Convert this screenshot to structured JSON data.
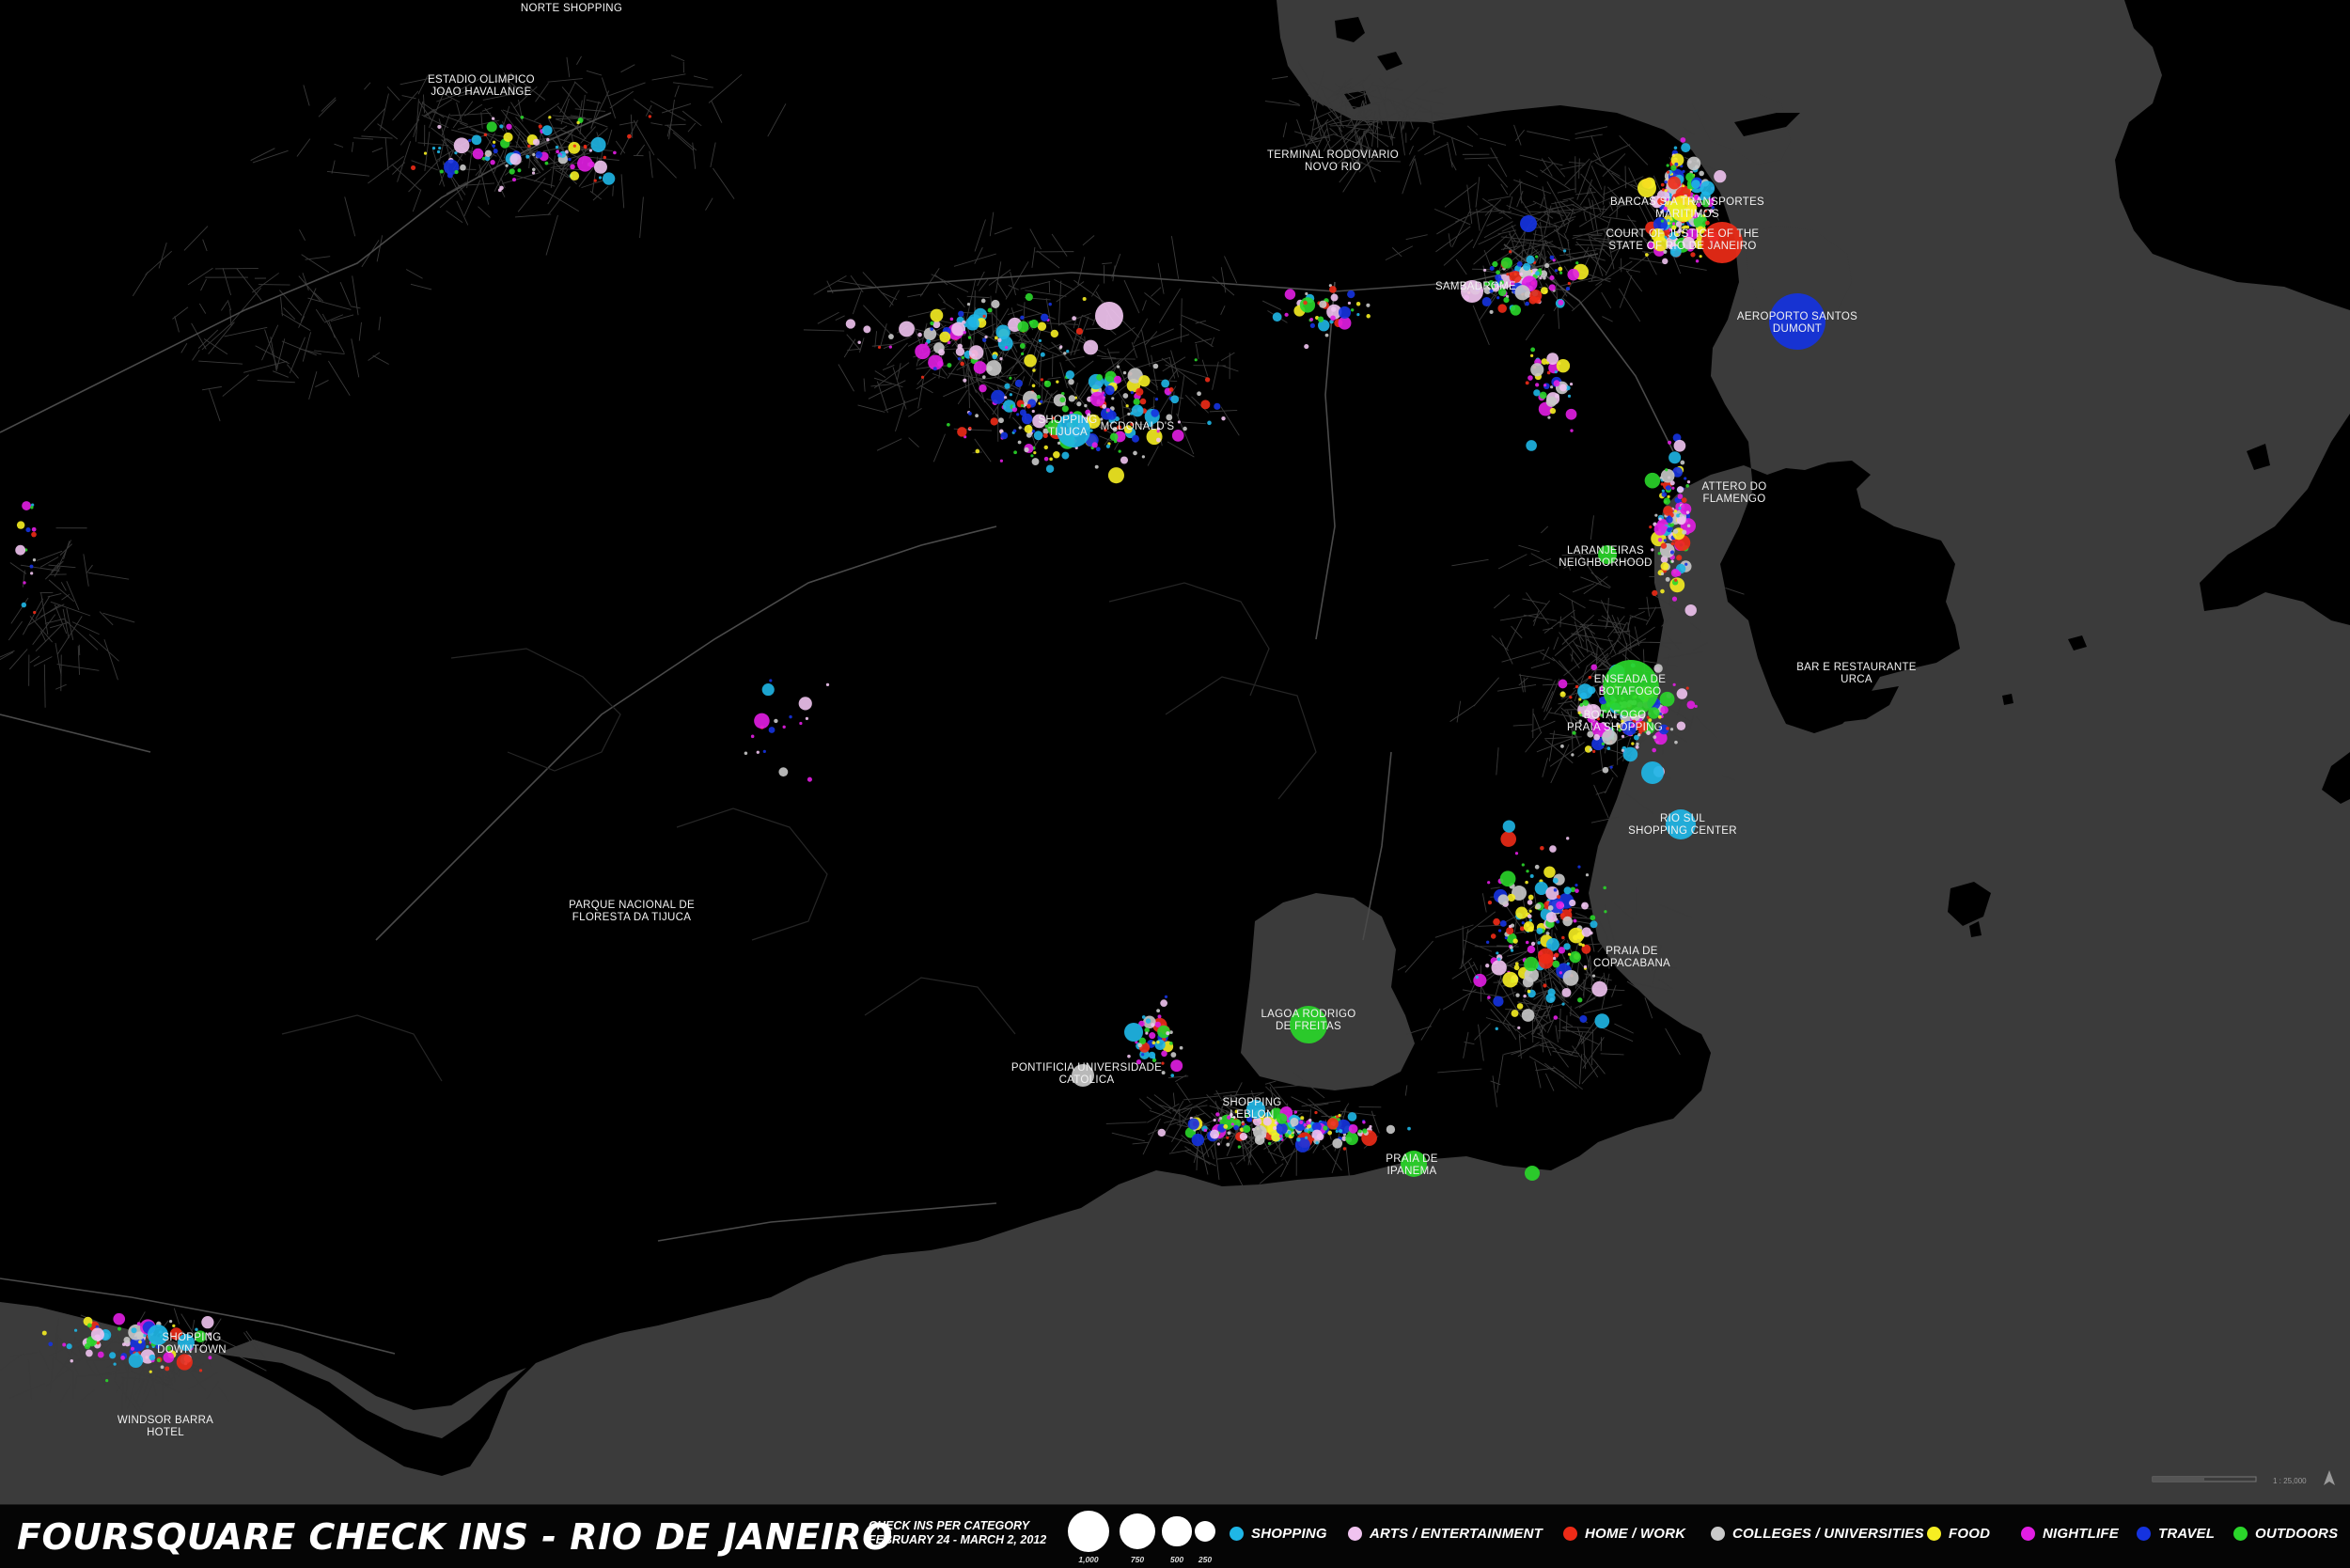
{
  "title": "FOURSQUARE CHECK INS - RIO DE JANEIRO",
  "subtitle": {
    "line1": "CHECK INS PER CATEGORY",
    "line2": "FEBRUARY 24 - MARCH 2, 2012"
  },
  "size_legend": [
    {
      "label": "1,000",
      "value": 1000
    },
    {
      "label": "750",
      "value": 750
    },
    {
      "label": "500",
      "value": 500
    },
    {
      "label": "250",
      "value": 250
    }
  ],
  "categories": [
    {
      "label": "SHOPPING",
      "color": "#1fb6e6"
    },
    {
      "label": "ARTS / ENTERTAINMENT",
      "color": "#f0c3ef"
    },
    {
      "label": "HOME / WORK",
      "color": "#ee2b17"
    },
    {
      "label": "COLLEGES / UNIVERSITIES",
      "color": "#c9c9c9"
    },
    {
      "label": "FOOD",
      "color": "#f6ee22"
    },
    {
      "label": "NIGHTLIFE",
      "color": "#e21ee3"
    },
    {
      "label": "TRAVEL",
      "color": "#1533e0"
    },
    {
      "label": "OUTDOORS",
      "color": "#2ad62a"
    }
  ],
  "map": {
    "water_color": "#3b3b3b",
    "land_color": "#000000",
    "scale_text": "1 : 25,000",
    "north_arrow_icon": "north-arrow-icon",
    "labels": [
      {
        "id": "norte-shopping",
        "lines": [
          "NORTE SHOPPING"
        ]
      },
      {
        "id": "estadio-olimpico",
        "lines": [
          "ESTADIO OLIMPICO",
          "JOAO HAVALANGE"
        ]
      },
      {
        "id": "terminal-rodoviario",
        "lines": [
          "TERMINAL RODOVIARIO",
          "NOVO RIO"
        ]
      },
      {
        "id": "barcas",
        "lines": [
          "BARCAS S/A TRANSPORTES",
          "MARITIMOS"
        ]
      },
      {
        "id": "court-of-justice",
        "lines": [
          "COURT OF JUSTICE OF THE",
          "STATE OF RIO DE JANEIRO"
        ]
      },
      {
        "id": "sambadrome",
        "lines": [
          "SAMBADROME"
        ]
      },
      {
        "id": "aeroporto-santos-dumont",
        "lines": [
          "AEROPORTO SANTOS",
          "DUMONT"
        ]
      },
      {
        "id": "shopping-tijuca",
        "lines": [
          "SHOPPING",
          "TIJUCA"
        ]
      },
      {
        "id": "mcdonalds",
        "lines": [
          "MCDONALD'S"
        ]
      },
      {
        "id": "attero-do-flamengo",
        "lines": [
          "ATTERO DO",
          "FLAMENGO"
        ]
      },
      {
        "id": "laranjeiras",
        "lines": [
          "LARANJEIRAS",
          "NEIGHBORHOOD"
        ]
      },
      {
        "id": "enseada-de-botafogo",
        "lines": [
          "ENSEADA DE",
          "BOTAFOGO"
        ]
      },
      {
        "id": "botafogo-praia-shopping",
        "lines": [
          "BOTAFOGO",
          "PRAIA SHOPPING"
        ]
      },
      {
        "id": "bar-e-restaurante-urca",
        "lines": [
          "BAR E RESTAURANTE",
          "URCA"
        ]
      },
      {
        "id": "rio-sul",
        "lines": [
          "RIO SUL",
          "SHOPPING CENTER"
        ]
      },
      {
        "id": "parque-nacional",
        "lines": [
          "PARQUE NACIONAL DE",
          "FLORESTA DA TIJUCA"
        ]
      },
      {
        "id": "praia-de-copacabana",
        "lines": [
          "PRAIA DE",
          "COPACABANA"
        ]
      },
      {
        "id": "lagoa-rodrigo-de-freitas",
        "lines": [
          "LAGOA RODRIGO",
          "DE FREITAS"
        ]
      },
      {
        "id": "puc",
        "lines": [
          "PONTIFICIA UNIVERSIDADE",
          "CATOLICA"
        ]
      },
      {
        "id": "shopping-leblon",
        "lines": [
          "SHOPPING",
          "LEBLON"
        ]
      },
      {
        "id": "praia-de-ipanema",
        "lines": [
          "PRAIA DE",
          "IPANEMA"
        ]
      },
      {
        "id": "shopping-downtown",
        "lines": [
          "SHOPPING",
          "DOWNTOWN"
        ]
      },
      {
        "id": "windsor-barra-hotel",
        "lines": [
          "WINDSOR BARRA",
          "HOTEL"
        ]
      }
    ]
  }
}
